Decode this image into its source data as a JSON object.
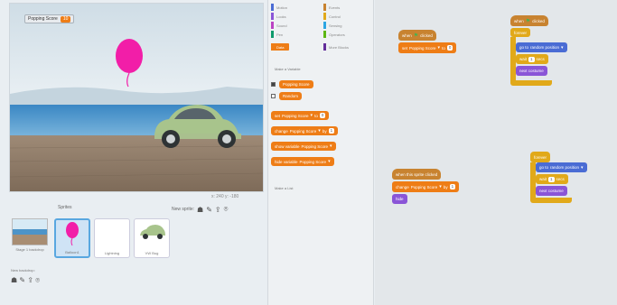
{
  "stage": {
    "variable_monitor": {
      "name": "Popping Score",
      "value": "10"
    },
    "tools_text": "x: 240  y: -180"
  },
  "sprites_panel": {
    "title": "Sprites",
    "new_sprite_label": "New sprite:",
    "stage_thumb_label": "Stage 1 backdrop",
    "new_backdrop_label": "New backdrop:",
    "sprites": [
      {
        "name": "Balloon1"
      },
      {
        "name": "Lightning"
      },
      {
        "name": "VW Bug"
      }
    ]
  },
  "palette": {
    "categories_left": [
      {
        "name": "Motion",
        "color": "#4a6cd4"
      },
      {
        "name": "Looks",
        "color": "#8a55d7"
      },
      {
        "name": "Sound",
        "color": "#bb42c3"
      },
      {
        "name": "Pen",
        "color": "#0e9a6c"
      },
      {
        "name": "Data",
        "color": "#ee7d16",
        "selected": true
      }
    ],
    "categories_right": [
      {
        "name": "Events",
        "color": "#c88330"
      },
      {
        "name": "Control",
        "color": "#e1a91a"
      },
      {
        "name": "Sensing",
        "color": "#2ca5e2"
      },
      {
        "name": "Operators",
        "color": "#5cb712"
      },
      {
        "name": "More Blocks",
        "color": "#632d99"
      }
    ],
    "make_variable": "Make a Variable",
    "variables": [
      "Popping Score",
      "Random"
    ],
    "data_blocks": [
      {
        "text": "set",
        "slot1": "Popping Score",
        "kw": "to",
        "slot2": "0"
      },
      {
        "text": "change",
        "slot1": "Popping Score",
        "kw": "by",
        "slot2": "1"
      },
      {
        "text": "show variable",
        "slot1": "Popping Score"
      },
      {
        "text": "hide variable",
        "slot1": "Popping Score"
      }
    ],
    "make_list": "Make a List"
  },
  "scripts": {
    "s1": {
      "hat": "when",
      "hat2": "clicked",
      "set_kw": "set",
      "var": "Popping Score",
      "to": "to",
      "val": "0"
    },
    "s2": {
      "hat": "when",
      "hat2": "clicked",
      "loop": "forever",
      "go": "go to",
      "target": "random position",
      "wait": "wait",
      "secs": "1",
      "secs_kw": "secs",
      "looks": "next costume"
    },
    "s3": {
      "hat": "when this sprite clicked",
      "change": "change",
      "var": "Popping Score",
      "by": "by",
      "val": "1",
      "looks": "hide",
      "looks_val": "hide"
    },
    "s4": {
      "loop": "forever",
      "go": "go to",
      "target": "random position",
      "wait": "wait",
      "secs": "1",
      "secs_kw": "secs",
      "looks": "next costume"
    }
  },
  "colors": {
    "data": "#ee7d16",
    "events": "#c88330",
    "control": "#e1a91a",
    "motion": "#4a6cd4",
    "looks": "#8a55d7",
    "balloon": "#f21ea8"
  }
}
